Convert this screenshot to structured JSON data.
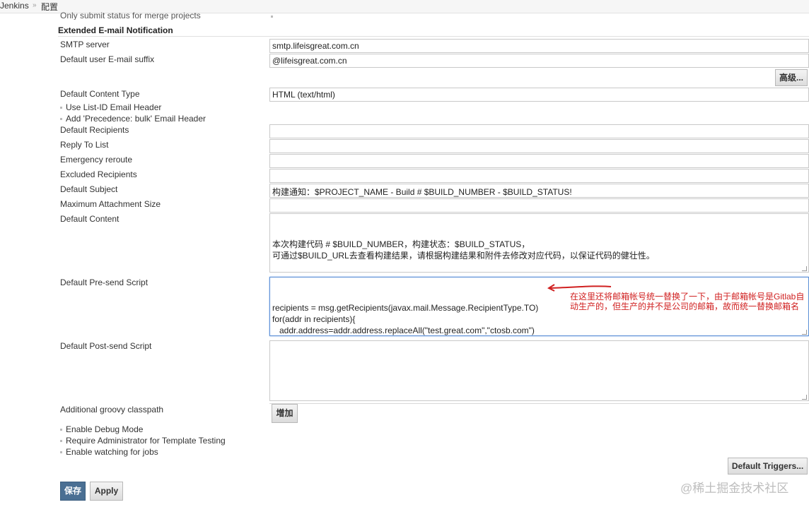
{
  "breadcrumb": {
    "jenkins": "Jenkins",
    "sep": "»",
    "config": "配置"
  },
  "prev_option": "Only submit status for merge projects",
  "section_title": "Extended E-mail Notification",
  "fields": {
    "smtp_server": {
      "label": "SMTP server",
      "value": "smtp.lifeisgreat.com.cn"
    },
    "email_suffix": {
      "label": "Default user E-mail suffix",
      "value": "@lifeisgreat.com.cn"
    },
    "content_type": {
      "label": "Default Content Type",
      "value": "HTML (text/html)"
    },
    "recipients": {
      "label": "Default Recipients",
      "value": ""
    },
    "reply_to": {
      "label": "Reply To List",
      "value": ""
    },
    "emergency": {
      "label": "Emergency reroute",
      "value": ""
    },
    "excluded": {
      "label": "Excluded Recipients",
      "value": ""
    },
    "subject": {
      "label": "Default Subject",
      "value": "构建通知：$PROJECT_NAME - Build # $BUILD_NUMBER - $BUILD_STATUS!"
    },
    "max_attach": {
      "label": "Maximum Attachment Size",
      "value": ""
    },
    "content": {
      "label": "Default Content",
      "value": "本次构建代码 # $BUILD_NUMBER，构建状态：$BUILD_STATUS，\n可通过$BUILD_URL去查看构建结果，请根据构建结果和附件去修改对应代码，以保证代码的健壮性。"
    },
    "presend": {
      "label": "Default Pre-send Script",
      "value": "recipients = msg.getRecipients(javax.mail.Message.RecipientType.TO)\nfor(addr in recipients){\n   addr.address=addr.address.replaceAll(\"test.great.com\",\"ctosb.com\")\n}\nmsg.setRecipients(javax.mail.Message.RecipientType.TO, recipients)"
    },
    "postsend": {
      "label": "Default Post-send Script",
      "value": ""
    },
    "classpath": {
      "label": "Additional groovy classpath"
    }
  },
  "checkboxes": {
    "list_id": "Use List-ID Email Header",
    "precedence": "Add 'Precedence: bulk' Email Header",
    "debug": "Enable Debug Mode",
    "require_admin": "Require Administrator for Template Testing",
    "watching": "Enable watching for jobs"
  },
  "buttons": {
    "advanced": "高级...",
    "add": "增加",
    "default_triggers": "Default Triggers...",
    "save": "保存",
    "apply": "Apply"
  },
  "annotation": {
    "line1": "在这里还将邮箱帐号统一替换了一下，由于邮箱帐号是Gitlab自",
    "line2": "动生产的，但生产的并不是公司的邮箱，故而统一替换邮箱名",
    "color": "#d02020"
  },
  "watermark": "@稀土掘金技术社区",
  "colors": {
    "primary_button": "#4a6f93",
    "focus_border": "#5b8fd6"
  }
}
